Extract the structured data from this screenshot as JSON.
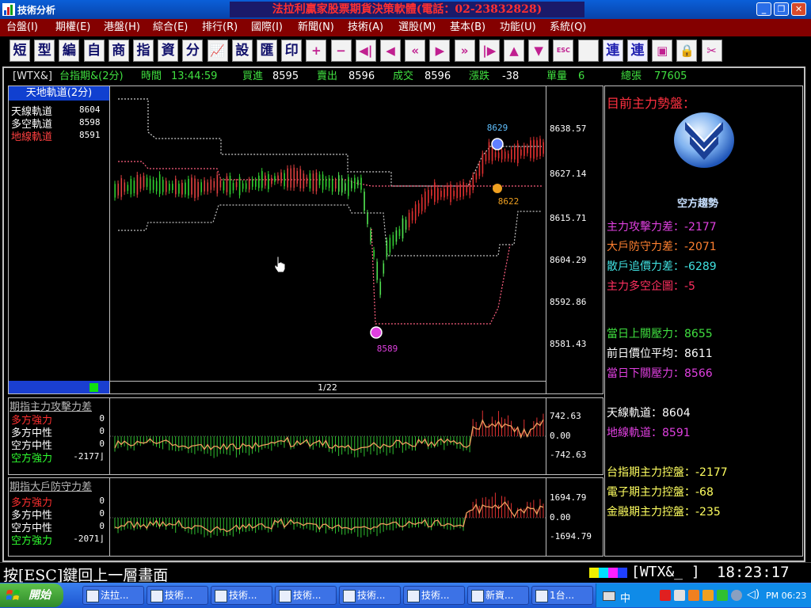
{
  "window": {
    "title": "技術分析",
    "banner": "法拉利贏家股票期貨決策軟體(電話：02-23832828)"
  },
  "menu": [
    "台盤(I)",
    "期權(E)",
    "港盤(H)",
    "綜合(E)",
    "排行(R)",
    "國際(I)",
    "新聞(N)",
    "技術(A)",
    "選股(M)",
    "基本(B)",
    "功能(U)",
    "系統(Q)"
  ],
  "toolbar": {
    "chars": [
      "短",
      "型",
      "編",
      "自",
      "商",
      "指",
      "資",
      "分",
      "",
      "設",
      "匯",
      "印",
      "",
      "",
      "",
      "",
      "",
      "",
      "",
      "",
      "",
      "",
      "",
      "",
      "連",
      "連",
      "",
      "",
      ""
    ],
    "icons": [
      "",
      "",
      "",
      "",
      "",
      "",
      "",
      "",
      "chart-icon",
      "",
      "",
      "",
      "plus-icon",
      "minus-icon",
      "first-icon",
      "prev-icon",
      "prev-fast-icon",
      "next-icon",
      "next-fast-icon",
      "last-icon",
      "up-icon",
      "down-icon",
      "esc-icon",
      "",
      "",
      "",
      "window-icon",
      "lock-icon",
      "tools-icon"
    ],
    "esc_label": "ESC"
  },
  "quote": {
    "symbol": "[WTX&]",
    "name": "台指期&(2分)",
    "time_label": "時間",
    "time": "13:44:59",
    "bid_label": "買進",
    "bid": "8595",
    "ask_label": "賣出",
    "ask": "8596",
    "last_label": "成交",
    "last": "8596",
    "change_label": "漲跌",
    "change": "-38",
    "vol_label": "單量",
    "vol": "6",
    "total_label": "總張",
    "total": "77605"
  },
  "main_chart": {
    "header": "天地軌道(2分)",
    "legend": [
      {
        "label": "天線軌道",
        "value": "8604",
        "color": "#ffffff"
      },
      {
        "label": "多空軌道",
        "value": "8598",
        "color": "#ffffff"
      },
      {
        "label": "地線軌道",
        "value": "8591",
        "color": "#ff4040"
      }
    ],
    "y_ticks": [
      "8638.57",
      "8627.14",
      "8615.71",
      "8604.29",
      "8592.86",
      "8581.43"
    ],
    "marker_high": "8629",
    "marker_mid": "8622",
    "marker_low": "8589",
    "page": "1/22"
  },
  "chart_data": [
    {
      "type": "candlestick",
      "title": "天地軌道(2分)",
      "ylim": [
        8570,
        8650
      ],
      "y_ticks": [
        8638.57,
        8627.14,
        8615.71,
        8604.29,
        8592.86,
        8581.43
      ],
      "annotations": [
        {
          "label": "8629"
        },
        {
          "label": "8622"
        },
        {
          "label": "8589"
        }
      ],
      "series": [
        {
          "name": "天線軌道",
          "last": 8604
        },
        {
          "name": "多空軌道",
          "last": 8598
        },
        {
          "name": "地線軌道",
          "last": 8591
        }
      ]
    },
    {
      "type": "bar",
      "title": "期指主力攻擊力差",
      "y_ticks": [
        742.63,
        0.0,
        -742.63
      ],
      "series": [
        {
          "name": "多方強力",
          "last": 0
        },
        {
          "name": "多方中性",
          "last": 0
        },
        {
          "name": "空方中性",
          "last": 0
        },
        {
          "name": "空方強力",
          "last": -2177
        }
      ]
    },
    {
      "type": "bar",
      "title": "期指大戶防守力差",
      "y_ticks": [
        1694.79,
        0.0,
        -1694.79
      ],
      "series": [
        {
          "name": "多方強力",
          "last": 0
        },
        {
          "name": "多方中性",
          "last": 0
        },
        {
          "name": "空方中性",
          "last": 0
        },
        {
          "name": "空方強力",
          "last": -2071
        }
      ]
    }
  ],
  "sub1": {
    "title": "期指主力攻擊力差",
    "rows": [
      {
        "label": "多方強力",
        "value": "0",
        "color": "#ff3030"
      },
      {
        "label": "多方中性",
        "value": "0",
        "color": "#ffffff"
      },
      {
        "label": "空方中性",
        "value": "0",
        "color": "#ffffff"
      },
      {
        "label": "空方強力",
        "value": "-2177⌋",
        "color": "#30ff30"
      }
    ],
    "y_ticks": [
      "742.63",
      "0.00",
      "-742.63"
    ]
  },
  "sub2": {
    "title": "期指大戶防守力差",
    "rows": [
      {
        "label": "多方強力",
        "value": "0",
        "color": "#ff3030"
      },
      {
        "label": "多方中性",
        "value": "0",
        "color": "#ffffff"
      },
      {
        "label": "空方中性",
        "value": "0",
        "color": "#ffffff"
      },
      {
        "label": "空方強力",
        "value": "-2071⌋",
        "color": "#30ff30"
      }
    ],
    "y_ticks": [
      "1694.79",
      "0.00",
      "-1694.79"
    ]
  },
  "right": {
    "header": "目前主力勢盤：",
    "trend": "空方趨勢",
    "lines": [
      {
        "text": "主力攻擊力差：-2177",
        "color": "#e040e0"
      },
      {
        "text": "大戶防守力差：-2071",
        "color": "#ff8030"
      },
      {
        "text": "散戶追價力差：-6289",
        "color": "#40e0e0"
      },
      {
        "text": "主力多空企圖：-5",
        "color": "#ff3060"
      },
      {
        "text": "當日上關壓力：8655",
        "color": "#40e040"
      },
      {
        "text": "前日價位平均：8611",
        "color": "#ffffff"
      },
      {
        "text": "當日下關壓力：8566",
        "color": "#e040e0"
      },
      {
        "text": "天線軌道：8604",
        "color": "#ffffff"
      },
      {
        "text": "地線軌道：8591",
        "color": "#e040e0"
      },
      {
        "text": "台指期主力控盤：-2177",
        "color": "#ffff60"
      },
      {
        "text": "電子期主力控盤：-68",
        "color": "#ffff60"
      },
      {
        "text": "金融期主力控盤：-235",
        "color": "#ffff60"
      }
    ]
  },
  "status": {
    "esc_hint": "按[ESC]鍵回上一層畫面",
    "symbol": "[WTX&_ ]",
    "clock": "18:23:17"
  },
  "taskbar": {
    "start": "開始",
    "tasks": [
      "法拉...",
      "技術...",
      "技術...",
      "技術...",
      "技術...",
      "技術...",
      "新資...",
      "1台..."
    ],
    "clock": "PM 06:23"
  }
}
